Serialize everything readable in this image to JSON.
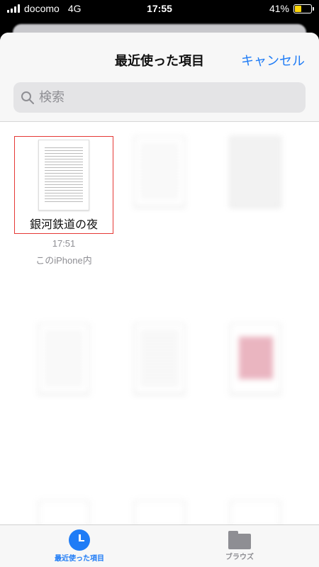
{
  "status": {
    "carrier": "docomo",
    "network": "4G",
    "time": "17:55",
    "battery": "41%",
    "battery_level": 0.41,
    "battery_color": "#ffd60a"
  },
  "sheet": {
    "title": "最近使った項目",
    "cancel_label": "キャンセル",
    "accent_color": "#1f7cf6"
  },
  "search": {
    "placeholder": "検索",
    "icon": "search-icon"
  },
  "files": {
    "f1": {
      "name": "銀河鉄道の夜",
      "time": "17:51",
      "location": "このiPhone内"
    }
  },
  "tabs": {
    "recent_label": "最近使った項目",
    "recent_icon": "clock-icon",
    "browse_label": "ブラウズ",
    "browse_icon": "folder-icon"
  }
}
